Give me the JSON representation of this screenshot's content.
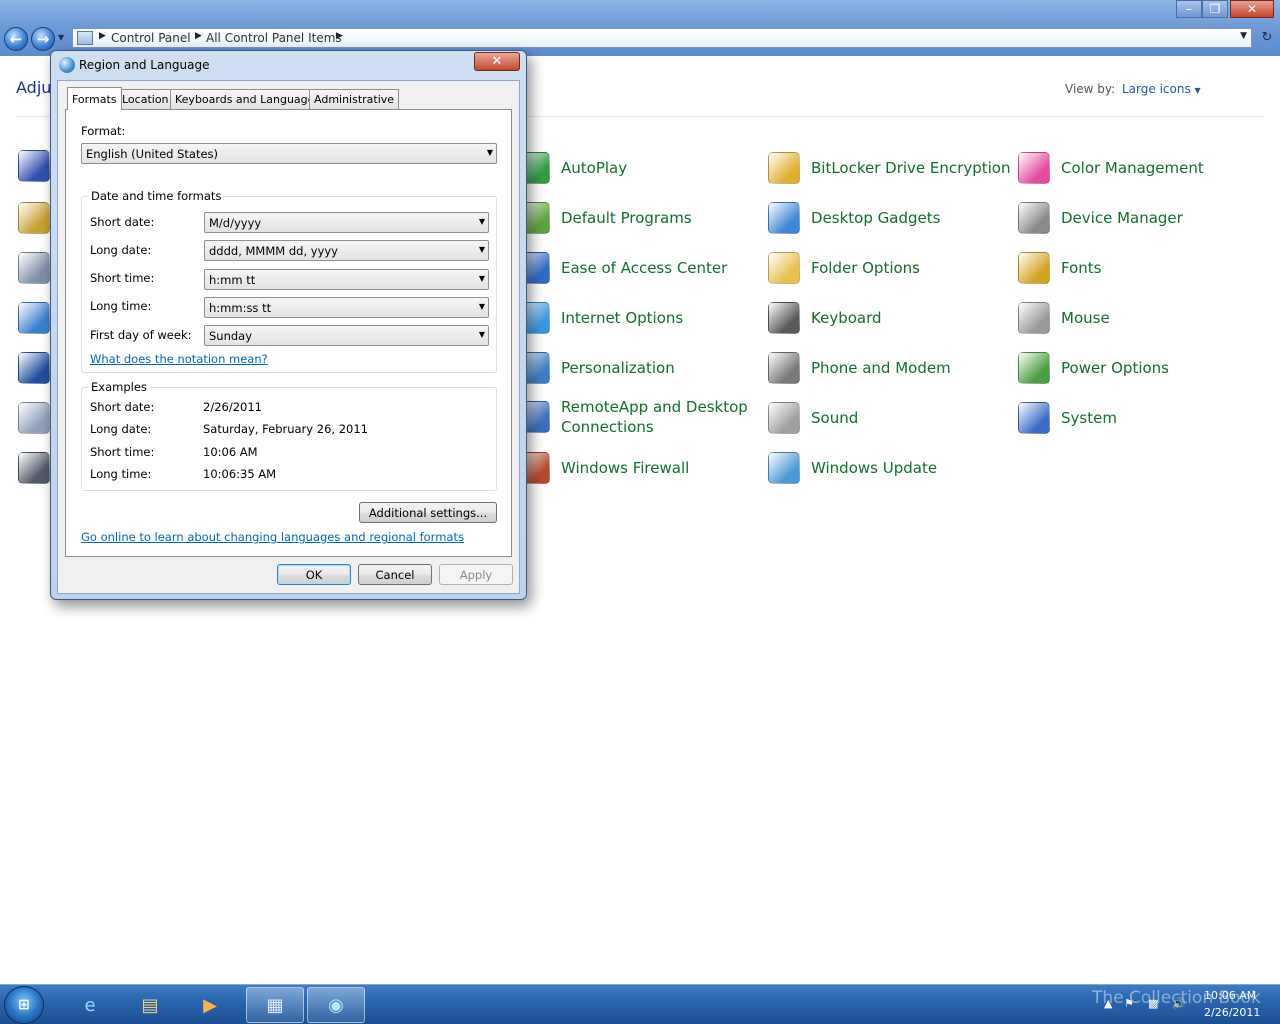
{
  "breadcrumb": [
    "Control Panel",
    "All Control Panel Items"
  ],
  "heading": "Adju",
  "view_by": {
    "label": "View by:",
    "value": "Large icons"
  },
  "items": [
    "AutoPlay",
    "BitLocker Drive Encryption",
    "Color Management",
    "Default Programs",
    "Desktop Gadgets",
    "Device Manager",
    "Ease of Access Center",
    "Folder Options",
    "Fonts",
    "Internet Options",
    "Keyboard",
    "Mouse",
    "Personalization",
    "Phone and Modem",
    "Power Options",
    "RemoteApp and Desktop Connections",
    "Sound",
    "System",
    "Windows Firewall",
    "Windows Update"
  ],
  "item_colors": [
    "#2f9e44",
    "#e0b030",
    "#e64a9e",
    "#5aa63c",
    "#3a8ad6",
    "#8a8a8a",
    "#2e6cc8",
    "#e8c04a",
    "#d4a420",
    "#3a9ae0",
    "#5a5a5a",
    "#9a9a9a",
    "#3a80c8",
    "#7a7a7a",
    "#4aa040",
    "#3a70c0",
    "#a0a0a0",
    "#3a6ec8",
    "#b84a2a",
    "#4a9ad6"
  ],
  "left_icon_colors": [
    "#3050b0",
    "#c8a030",
    "#8090a8",
    "#3a80d0",
    "#2050a0",
    "#90a0b8",
    "#505a68"
  ],
  "dialog": {
    "title": "Region and Language",
    "tabs": [
      "Formats",
      "Location",
      "Keyboards and Languages",
      "Administrative"
    ],
    "format_label": "Format:",
    "format_value": "English (United States)",
    "group_title": "Date and time formats",
    "fields": [
      {
        "label": "Short date:",
        "value": "M/d/yyyy"
      },
      {
        "label": "Long date:",
        "value": "dddd, MMMM dd, yyyy"
      },
      {
        "label": "Short time:",
        "value": "h:mm tt"
      },
      {
        "label": "Long time:",
        "value": "h:mm:ss tt"
      },
      {
        "label": "First day of week:",
        "value": "Sunday"
      }
    ],
    "notation_link": "What does the notation mean?",
    "examples_title": "Examples",
    "examples": [
      {
        "label": "Short date:",
        "value": "2/26/2011"
      },
      {
        "label": "Long date:",
        "value": "Saturday, February 26, 2011"
      },
      {
        "label": "Short time:",
        "value": "10:06 AM"
      },
      {
        "label": "Long time:",
        "value": "10:06:35 AM"
      }
    ],
    "additional_settings": "Additional settings...",
    "online_link": "Go online to learn about changing languages and regional formats",
    "ok": "OK",
    "cancel": "Cancel",
    "apply": "Apply"
  },
  "taskbar": {
    "watermark": "The Collection Book",
    "time": "10:06 AM",
    "date": "2/26/2011"
  }
}
